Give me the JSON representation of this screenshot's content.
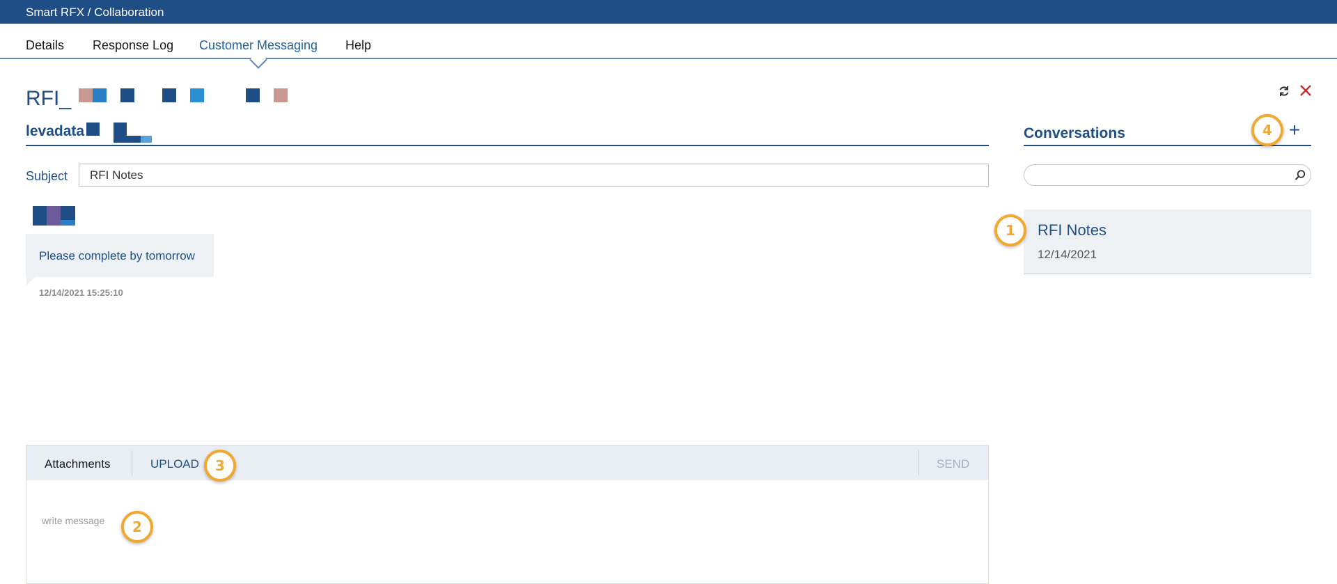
{
  "app": {
    "title": "Smart RFX / Collaboration"
  },
  "nav": {
    "tabs": [
      {
        "label": "Details"
      },
      {
        "label": "Response Log"
      },
      {
        "label": "Customer Messaging",
        "active": true
      },
      {
        "label": "Help"
      }
    ]
  },
  "header": {
    "rfi_title": "RFI_",
    "org_name": "levadata",
    "icons": {
      "refresh": "refresh-icon",
      "close": "close-icon"
    },
    "colors": {
      "brand": "#1f4e86",
      "close": "#cc2a2a"
    }
  },
  "message": {
    "subject_label": "Subject",
    "subject_value": "RFI Notes",
    "items": [
      {
        "text": "Please complete by tomorrow",
        "timestamp": "12/14/2021 15:25:10"
      }
    ]
  },
  "compose": {
    "attachments_label": "Attachments",
    "upload_label": "UPLOAD",
    "send_label": "SEND",
    "placeholder": "write message"
  },
  "conversations": {
    "title": "Conversations",
    "add_label": "+",
    "search_placeholder": "",
    "items": [
      {
        "name": "RFI Notes",
        "date": "12/14/2021"
      }
    ]
  },
  "markers": [
    "1",
    "2",
    "3",
    "4"
  ],
  "marker_color": "#f0a830"
}
